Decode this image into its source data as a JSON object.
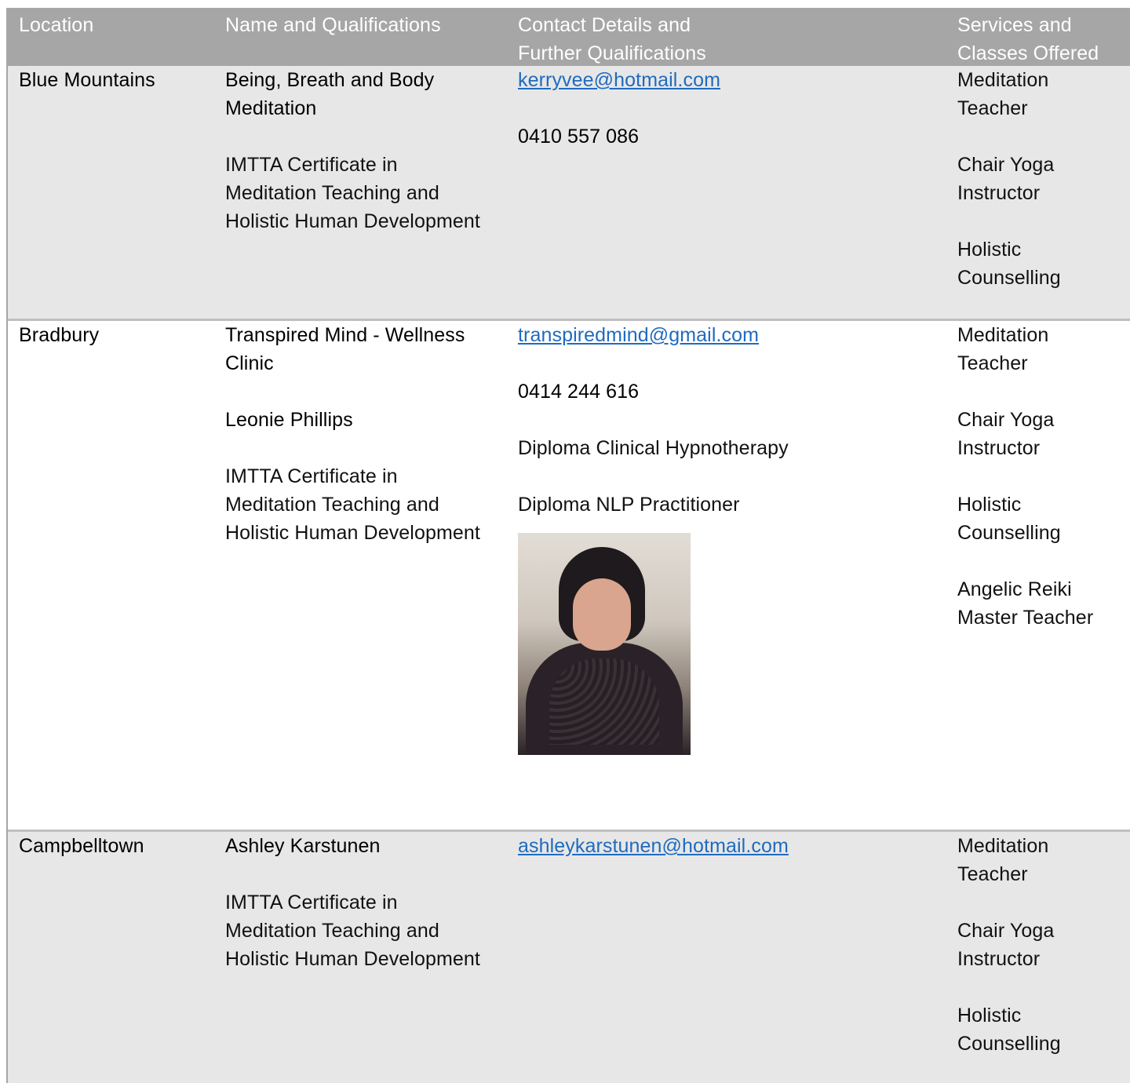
{
  "header": {
    "col1": "Location",
    "col2": "Name and Qualifications",
    "col3_line1": "Contact Details and",
    "col3_line2": "Further Qualifications",
    "col4_line1": "Services and",
    "col4_line2": "Classes Offered"
  },
  "rows": [
    {
      "location": "Blue Mountains",
      "name_line1": "Being, Breath and Body",
      "name_line2": "Meditation",
      "qual_line1": "IMTTA Certificate in",
      "qual_line2": "Meditation Teaching and",
      "qual_line3": "Holistic Human Development",
      "email": "kerryvee@hotmail.com",
      "phone": "0410 557 086",
      "services": [
        [
          "Meditation",
          "Teacher"
        ],
        [
          "Chair Yoga",
          "Instructor"
        ],
        [
          "Holistic",
          "Counselling"
        ]
      ]
    },
    {
      "location": "Bradbury",
      "name_line1": "Transpired Mind - Wellness",
      "name_line2": "Clinic",
      "person": "Leonie Phillips",
      "qual_line1": "IMTTA Certificate in",
      "qual_line2": "Meditation Teaching and",
      "qual_line3": "Holistic Human Development",
      "email": "transpiredmind@gmail.com",
      "phone": "0414 244 616",
      "extra1": "Diploma Clinical Hypnotherapy",
      "extra2": "Diploma NLP Practitioner",
      "services": [
        [
          "Meditation",
          "Teacher"
        ],
        [
          "Chair Yoga",
          "Instructor"
        ],
        [
          "Holistic",
          "Counselling"
        ],
        [
          "Angelic Reiki",
          "Master Teacher"
        ]
      ]
    },
    {
      "location": "Campbelltown",
      "name_line1": "Ashley Karstunen",
      "qual_line1": "IMTTA Certificate in",
      "qual_line2": "Meditation Teaching and",
      "qual_line3": "Holistic Human Development",
      "email": "ashleykarstunen@hotmail.com",
      "services": [
        [
          "Meditation",
          "Teacher"
        ],
        [
          "Chair Yoga",
          "Instructor"
        ],
        [
          "Holistic",
          "Counselling"
        ]
      ]
    }
  ],
  "colors": {
    "header_bg": "#a6a6a6",
    "shaded_row": "#e7e7e7",
    "link": "#1f6bbf"
  }
}
